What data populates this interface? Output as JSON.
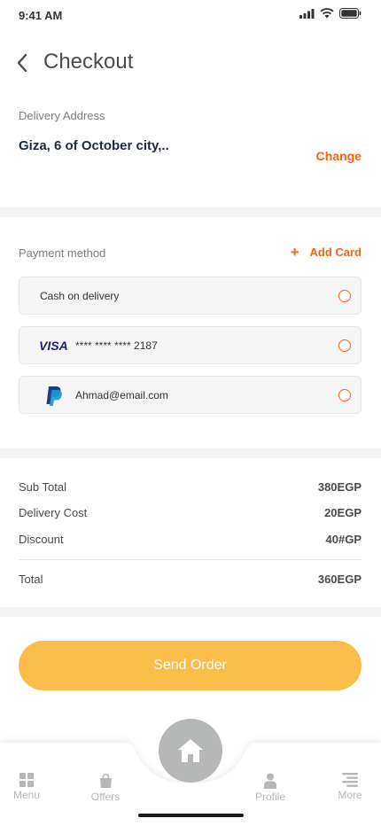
{
  "status_bar": {
    "time": "9:41 AM"
  },
  "header": {
    "title": "Checkout",
    "back_icon": "chevron-left-icon"
  },
  "delivery": {
    "label": "Delivery Address",
    "address": "Giza, 6 of October city,..",
    "change_label": "Change"
  },
  "payment": {
    "label": "Payment method",
    "add_card_label": "Add Card",
    "options": [
      {
        "text": "Cash on delivery",
        "icon": ""
      },
      {
        "text": "**** **** **** 2187",
        "icon": "visa-icon",
        "brand": "VISA"
      },
      {
        "text": "Ahmad@email.com",
        "icon": "paypal-icon"
      }
    ]
  },
  "summary": {
    "rows": [
      {
        "label": "Sub Total",
        "value": "380EGP"
      },
      {
        "label": "Delivery Cost",
        "value": "20EGP"
      },
      {
        "label": "Discount",
        "value": "40#GP"
      }
    ],
    "total": {
      "label": "Total",
      "value": "360EGP"
    }
  },
  "send_order_label": "Send Order",
  "nav": {
    "items": [
      {
        "label": "Menu",
        "icon": "grid-icon"
      },
      {
        "label": "Offers",
        "icon": "shopping-bag-icon"
      },
      {
        "label": "Profile",
        "icon": "user-icon"
      },
      {
        "label": "More",
        "icon": "menu-lines-icon"
      }
    ],
    "home_icon": "home-icon"
  },
  "colors": {
    "accent": "#fc6011",
    "button": "#fbbd4a",
    "nav_inactive": "#b6b7b7",
    "band": "#f4f4f4"
  }
}
